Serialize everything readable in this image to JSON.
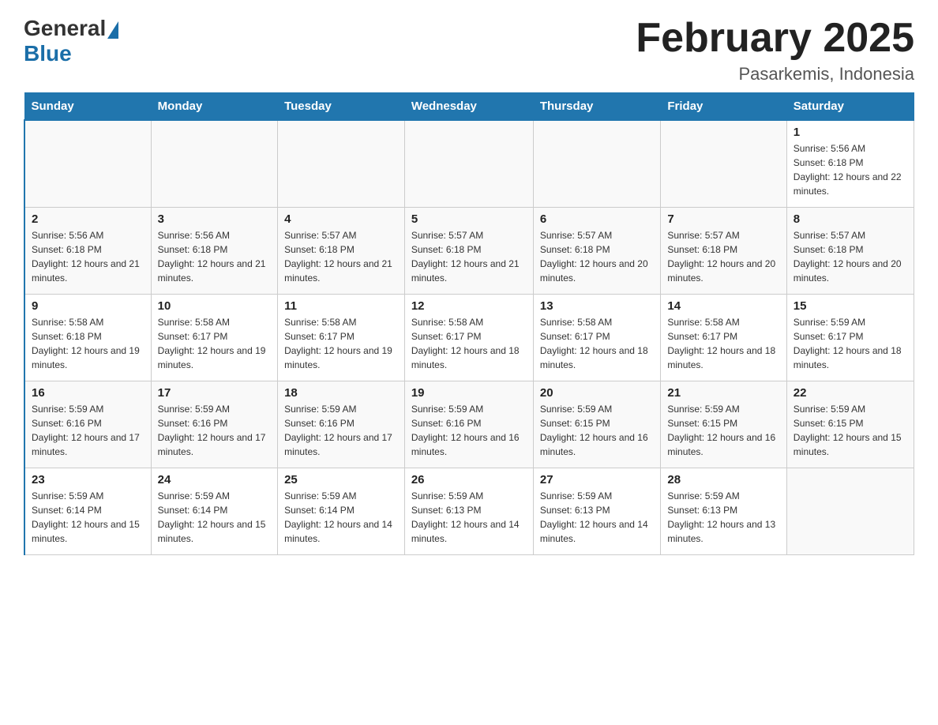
{
  "header": {
    "logo_general": "General",
    "logo_blue": "Blue",
    "title": "February 2025",
    "subtitle": "Pasarkemis, Indonesia"
  },
  "days_of_week": [
    "Sunday",
    "Monday",
    "Tuesday",
    "Wednesday",
    "Thursday",
    "Friday",
    "Saturday"
  ],
  "weeks": [
    [
      {
        "day": "",
        "info": ""
      },
      {
        "day": "",
        "info": ""
      },
      {
        "day": "",
        "info": ""
      },
      {
        "day": "",
        "info": ""
      },
      {
        "day": "",
        "info": ""
      },
      {
        "day": "",
        "info": ""
      },
      {
        "day": "1",
        "info": "Sunrise: 5:56 AM\nSunset: 6:18 PM\nDaylight: 12 hours and 22 minutes."
      }
    ],
    [
      {
        "day": "2",
        "info": "Sunrise: 5:56 AM\nSunset: 6:18 PM\nDaylight: 12 hours and 21 minutes."
      },
      {
        "day": "3",
        "info": "Sunrise: 5:56 AM\nSunset: 6:18 PM\nDaylight: 12 hours and 21 minutes."
      },
      {
        "day": "4",
        "info": "Sunrise: 5:57 AM\nSunset: 6:18 PM\nDaylight: 12 hours and 21 minutes."
      },
      {
        "day": "5",
        "info": "Sunrise: 5:57 AM\nSunset: 6:18 PM\nDaylight: 12 hours and 21 minutes."
      },
      {
        "day": "6",
        "info": "Sunrise: 5:57 AM\nSunset: 6:18 PM\nDaylight: 12 hours and 20 minutes."
      },
      {
        "day": "7",
        "info": "Sunrise: 5:57 AM\nSunset: 6:18 PM\nDaylight: 12 hours and 20 minutes."
      },
      {
        "day": "8",
        "info": "Sunrise: 5:57 AM\nSunset: 6:18 PM\nDaylight: 12 hours and 20 minutes."
      }
    ],
    [
      {
        "day": "9",
        "info": "Sunrise: 5:58 AM\nSunset: 6:18 PM\nDaylight: 12 hours and 19 minutes."
      },
      {
        "day": "10",
        "info": "Sunrise: 5:58 AM\nSunset: 6:17 PM\nDaylight: 12 hours and 19 minutes."
      },
      {
        "day": "11",
        "info": "Sunrise: 5:58 AM\nSunset: 6:17 PM\nDaylight: 12 hours and 19 minutes."
      },
      {
        "day": "12",
        "info": "Sunrise: 5:58 AM\nSunset: 6:17 PM\nDaylight: 12 hours and 18 minutes."
      },
      {
        "day": "13",
        "info": "Sunrise: 5:58 AM\nSunset: 6:17 PM\nDaylight: 12 hours and 18 minutes."
      },
      {
        "day": "14",
        "info": "Sunrise: 5:58 AM\nSunset: 6:17 PM\nDaylight: 12 hours and 18 minutes."
      },
      {
        "day": "15",
        "info": "Sunrise: 5:59 AM\nSunset: 6:17 PM\nDaylight: 12 hours and 18 minutes."
      }
    ],
    [
      {
        "day": "16",
        "info": "Sunrise: 5:59 AM\nSunset: 6:16 PM\nDaylight: 12 hours and 17 minutes."
      },
      {
        "day": "17",
        "info": "Sunrise: 5:59 AM\nSunset: 6:16 PM\nDaylight: 12 hours and 17 minutes."
      },
      {
        "day": "18",
        "info": "Sunrise: 5:59 AM\nSunset: 6:16 PM\nDaylight: 12 hours and 17 minutes."
      },
      {
        "day": "19",
        "info": "Sunrise: 5:59 AM\nSunset: 6:16 PM\nDaylight: 12 hours and 16 minutes."
      },
      {
        "day": "20",
        "info": "Sunrise: 5:59 AM\nSunset: 6:15 PM\nDaylight: 12 hours and 16 minutes."
      },
      {
        "day": "21",
        "info": "Sunrise: 5:59 AM\nSunset: 6:15 PM\nDaylight: 12 hours and 16 minutes."
      },
      {
        "day": "22",
        "info": "Sunrise: 5:59 AM\nSunset: 6:15 PM\nDaylight: 12 hours and 15 minutes."
      }
    ],
    [
      {
        "day": "23",
        "info": "Sunrise: 5:59 AM\nSunset: 6:14 PM\nDaylight: 12 hours and 15 minutes."
      },
      {
        "day": "24",
        "info": "Sunrise: 5:59 AM\nSunset: 6:14 PM\nDaylight: 12 hours and 15 minutes."
      },
      {
        "day": "25",
        "info": "Sunrise: 5:59 AM\nSunset: 6:14 PM\nDaylight: 12 hours and 14 minutes."
      },
      {
        "day": "26",
        "info": "Sunrise: 5:59 AM\nSunset: 6:13 PM\nDaylight: 12 hours and 14 minutes."
      },
      {
        "day": "27",
        "info": "Sunrise: 5:59 AM\nSunset: 6:13 PM\nDaylight: 12 hours and 14 minutes."
      },
      {
        "day": "28",
        "info": "Sunrise: 5:59 AM\nSunset: 6:13 PM\nDaylight: 12 hours and 13 minutes."
      },
      {
        "day": "",
        "info": ""
      }
    ]
  ]
}
